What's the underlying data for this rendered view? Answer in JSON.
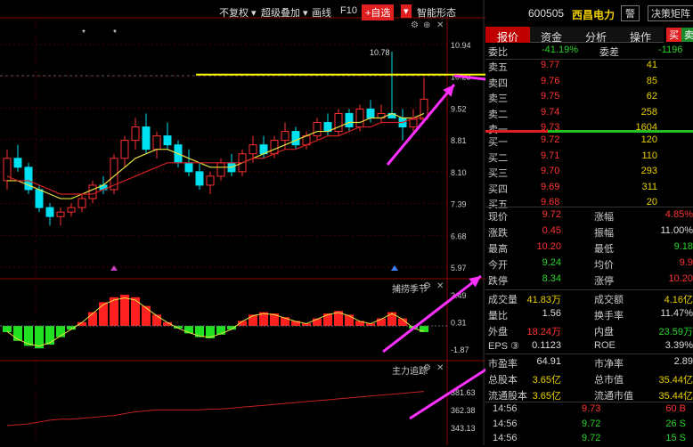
{
  "toolbar": {
    "fuquan": "不复权",
    "overlay": "超级叠加",
    "draw": "画线",
    "f10": "F10",
    "add_fav": "+自选",
    "smart_form": "智能形态"
  },
  "stock": {
    "code": "600505",
    "name": "西昌电力",
    "alert_btn": "警",
    "decision_btn": "决策矩阵"
  },
  "tabs": [
    "报价",
    "资金",
    "分析",
    "操作"
  ],
  "mini_buttons": [
    "买",
    "卖"
  ],
  "weibi": {
    "label1": "委比",
    "val1": "-41.19%",
    "label2": "委差",
    "val2": "-1196"
  },
  "sell": [
    {
      "label": "卖五",
      "price": "9.77",
      "vol": "41"
    },
    {
      "label": "卖四",
      "price": "9.76",
      "vol": "85"
    },
    {
      "label": "卖三",
      "price": "9.75",
      "vol": "62"
    },
    {
      "label": "卖二",
      "price": "9.74",
      "vol": "258"
    },
    {
      "label": "卖一",
      "price": "9.73",
      "vol": "1604"
    }
  ],
  "buy": [
    {
      "label": "买一",
      "price": "9.72",
      "vol": "120"
    },
    {
      "label": "买二",
      "price": "9.71",
      "vol": "110"
    },
    {
      "label": "买三",
      "price": "9.70",
      "vol": "293"
    },
    {
      "label": "买四",
      "price": "9.69",
      "vol": "311"
    },
    {
      "label": "买五",
      "price": "9.68",
      "vol": "20"
    }
  ],
  "quote": [
    {
      "l1": "现价",
      "v1": "9.72",
      "l2": "涨幅",
      "v2": "4.85%"
    },
    {
      "l1": "涨跌",
      "v1": "0.45",
      "l2": "振幅",
      "v2": "11.00%"
    },
    {
      "l1": "最高",
      "v1": "10.20",
      "l2": "最低",
      "v2": "9.18"
    },
    {
      "l1": "今开",
      "v1": "9.24",
      "l2": "均价",
      "v2": "9.9"
    },
    {
      "l1": "跌停",
      "v1": "8.34",
      "l2": "涨停",
      "v2": "10.20"
    }
  ],
  "volume": [
    {
      "l1": "成交量",
      "v1": "41.83万",
      "l2": "成交额",
      "v2": "4.16亿"
    },
    {
      "l1": "量比",
      "v1": "1.56",
      "l2": "换手率",
      "v2": "11.47%"
    },
    {
      "l1": "外盘",
      "v1": "18.24万",
      "l2": "内盘",
      "v2": "23.59万"
    },
    {
      "l1": "EPS ③",
      "v1": "0.1123",
      "l2": "ROE",
      "v2": "3.39%"
    }
  ],
  "fundamentals": [
    {
      "l1": "市盈率",
      "v1": "64.91",
      "l2": "市净率",
      "v2": "2.89"
    },
    {
      "l1": "总股本",
      "v1": "3.65亿",
      "l2": "总市值",
      "v2": "35.44亿"
    },
    {
      "l1": "流通股本",
      "v1": "3.65亿",
      "l2": "流通市值",
      "v2": "35.44亿"
    }
  ],
  "ticks": [
    {
      "time": "14:56",
      "price": "9.73",
      "vol": "60 B"
    },
    {
      "time": "14:56",
      "price": "9.72",
      "vol": "26 S"
    },
    {
      "time": "14:56",
      "price": "9.72",
      "vol": "15 S"
    }
  ],
  "main_axis": [
    "10.94",
    "10.23",
    "9.52",
    "8.81",
    "8.10",
    "7.39",
    "6.68",
    "5.97"
  ],
  "high_label": "10.78",
  "ind1_title": "捕捞季节",
  "ind1_axis": [
    "2.49",
    "0.31",
    "-1.87"
  ],
  "ind2_title": "主力追踪",
  "ind2_axis": [
    "381.63",
    "362.38",
    "343.13"
  ],
  "chart_data": {
    "type": "candlestick",
    "ohlc": [
      [
        7.9,
        8.6,
        7.7,
        8.4
      ],
      [
        8.4,
        8.7,
        8.1,
        8.2
      ],
      [
        8.2,
        8.3,
        7.6,
        7.7
      ],
      [
        7.7,
        7.8,
        7.2,
        7.3
      ],
      [
        7.3,
        7.4,
        6.9,
        7.1
      ],
      [
        7.1,
        7.3,
        6.9,
        7.2
      ],
      [
        7.2,
        7.4,
        7.1,
        7.3
      ],
      [
        7.3,
        7.6,
        7.2,
        7.5
      ],
      [
        7.5,
        7.9,
        7.4,
        7.8
      ],
      [
        7.8,
        8.0,
        7.6,
        7.7
      ],
      [
        7.7,
        8.5,
        7.6,
        8.4
      ],
      [
        8.4,
        8.9,
        8.2,
        8.8
      ],
      [
        8.8,
        9.3,
        8.6,
        9.1
      ],
      [
        9.1,
        9.4,
        8.5,
        8.6
      ],
      [
        8.6,
        9.0,
        8.4,
        8.9
      ],
      [
        8.9,
        9.2,
        8.6,
        8.7
      ],
      [
        8.7,
        8.8,
        8.2,
        8.3
      ],
      [
        8.3,
        8.6,
        8.0,
        8.1
      ],
      [
        8.1,
        8.3,
        7.7,
        7.8
      ],
      [
        7.8,
        8.1,
        7.6,
        8.0
      ],
      [
        8.0,
        8.4,
        7.9,
        8.3
      ],
      [
        8.3,
        8.5,
        8.0,
        8.1
      ],
      [
        8.1,
        8.6,
        8.0,
        8.5
      ],
      [
        8.5,
        8.9,
        8.3,
        8.7
      ],
      [
        8.7,
        8.9,
        8.4,
        8.5
      ],
      [
        8.5,
        8.9,
        8.4,
        8.8
      ],
      [
        8.8,
        9.2,
        8.6,
        9.0
      ],
      [
        9.0,
        9.1,
        8.6,
        8.7
      ],
      [
        8.7,
        9.0,
        8.6,
        8.9
      ],
      [
        8.9,
        9.3,
        8.8,
        9.2
      ],
      [
        9.2,
        9.4,
        8.9,
        9.0
      ],
      [
        9.0,
        9.5,
        8.9,
        9.4
      ],
      [
        9.4,
        9.5,
        9.0,
        9.1
      ],
      [
        9.1,
        9.6,
        9.0,
        9.5
      ],
      [
        9.5,
        9.7,
        9.2,
        9.3
      ],
      [
        9.3,
        9.6,
        9.2,
        9.4
      ],
      [
        9.4,
        10.78,
        9.3,
        9.3
      ],
      [
        9.3,
        9.5,
        8.8,
        9.1
      ],
      [
        9.1,
        9.5,
        9.0,
        9.27
      ],
      [
        9.27,
        10.2,
        9.18,
        9.72
      ]
    ],
    "ma_fast": [
      7.9,
      7.9,
      7.8,
      7.7,
      7.6,
      7.5,
      7.5,
      7.6,
      7.7,
      7.8,
      8.0,
      8.2,
      8.4,
      8.5,
      8.6,
      8.6,
      8.5,
      8.4,
      8.3,
      8.2,
      8.2,
      8.2,
      8.3,
      8.4,
      8.5,
      8.6,
      8.7,
      8.8,
      8.9,
      9.0,
      9.0,
      9.1,
      9.2,
      9.2,
      9.3,
      9.3,
      9.4,
      9.3,
      9.3,
      9.4
    ],
    "ma_slow": [
      8.0,
      7.9,
      7.9,
      7.8,
      7.7,
      7.6,
      7.6,
      7.6,
      7.6,
      7.7,
      7.8,
      7.9,
      8.0,
      8.1,
      8.2,
      8.3,
      8.3,
      8.3,
      8.3,
      8.3,
      8.3,
      8.3,
      8.3,
      8.4,
      8.4,
      8.5,
      8.6,
      8.6,
      8.7,
      8.8,
      8.9,
      8.9,
      9.0,
      9.1,
      9.1,
      9.2,
      9.2,
      9.2,
      9.3,
      9.3
    ],
    "ind1_values": [
      -0.5,
      -1.2,
      -1.6,
      -1.8,
      -1.5,
      -0.9,
      -0.3,
      0.3,
      1.1,
      1.9,
      2.3,
      2.5,
      2.3,
      1.6,
      0.9,
      0.3,
      -0.2,
      -0.6,
      -0.9,
      -1.0,
      -0.7,
      -0.3,
      0.4,
      0.9,
      1.1,
      1.0,
      0.7,
      0.4,
      0.2,
      0.6,
      1.0,
      1.2,
      0.9,
      0.4,
      0.2,
      0.6,
      1.1,
      0.6,
      -0.2,
      -0.5
    ],
    "ind2_values": [
      345,
      346,
      347,
      349,
      351,
      352,
      352,
      353,
      354,
      355,
      356,
      358,
      360,
      361,
      362,
      362,
      362,
      362,
      362,
      363,
      363,
      364,
      365,
      366,
      367,
      368,
      369,
      370,
      371,
      372,
      373,
      374,
      375,
      376,
      377,
      378,
      379,
      380,
      381,
      382
    ],
    "ylim": [
      5.97,
      10.94
    ]
  }
}
